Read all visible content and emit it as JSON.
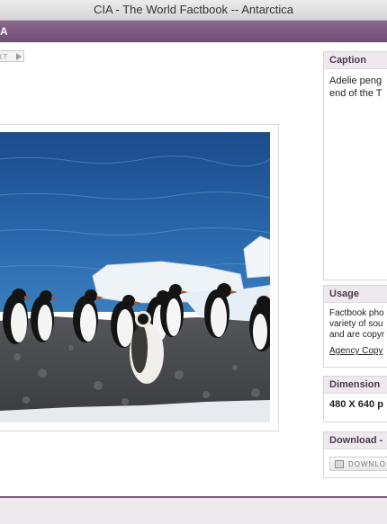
{
  "window": {
    "title": "CIA - The World Factbook -- Antarctica"
  },
  "header": {
    "label": "A"
  },
  "nav": {
    "next_label": "XT"
  },
  "caption": {
    "heading": "Caption",
    "line1": "Adelie peng",
    "line2": "end of the T"
  },
  "usage": {
    "heading": "Usage",
    "line1": "Factbook pho",
    "line2": "variety of sou",
    "line3": "and are copyr",
    "link": "Agency Copy"
  },
  "dimension": {
    "heading": "Dimension",
    "value": "480 X 640 p"
  },
  "download": {
    "heading": "Download -",
    "button_label": "DOWNLO"
  },
  "colors": {
    "purple_bar": "#7b587e",
    "panel_header": "#efe9ef",
    "footer_border": "#7a5a7d"
  }
}
